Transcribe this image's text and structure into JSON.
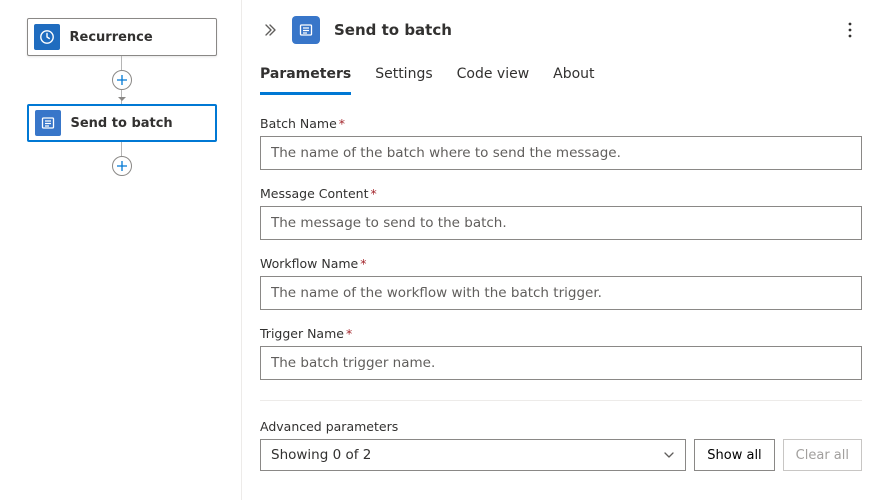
{
  "flow": {
    "recurrence_label": "Recurrence",
    "batch_label": "Send to batch"
  },
  "panel": {
    "title": "Send to batch",
    "tabs": {
      "parameters": "Parameters",
      "settings": "Settings",
      "codeview": "Code view",
      "about": "About"
    },
    "fields": {
      "batch_name": {
        "label": "Batch Name",
        "placeholder": "The name of the batch where to send the message."
      },
      "message_content": {
        "label": "Message Content",
        "placeholder": "The message to send to the batch."
      },
      "workflow_name": {
        "label": "Workflow Name",
        "placeholder": "The name of the workflow with the batch trigger."
      },
      "trigger_name": {
        "label": "Trigger Name",
        "placeholder": "The batch trigger name."
      }
    },
    "advanced": {
      "label": "Advanced parameters",
      "selected": "Showing 0 of 2",
      "show_all": "Show all",
      "clear_all": "Clear all"
    }
  },
  "required_marker": "*"
}
